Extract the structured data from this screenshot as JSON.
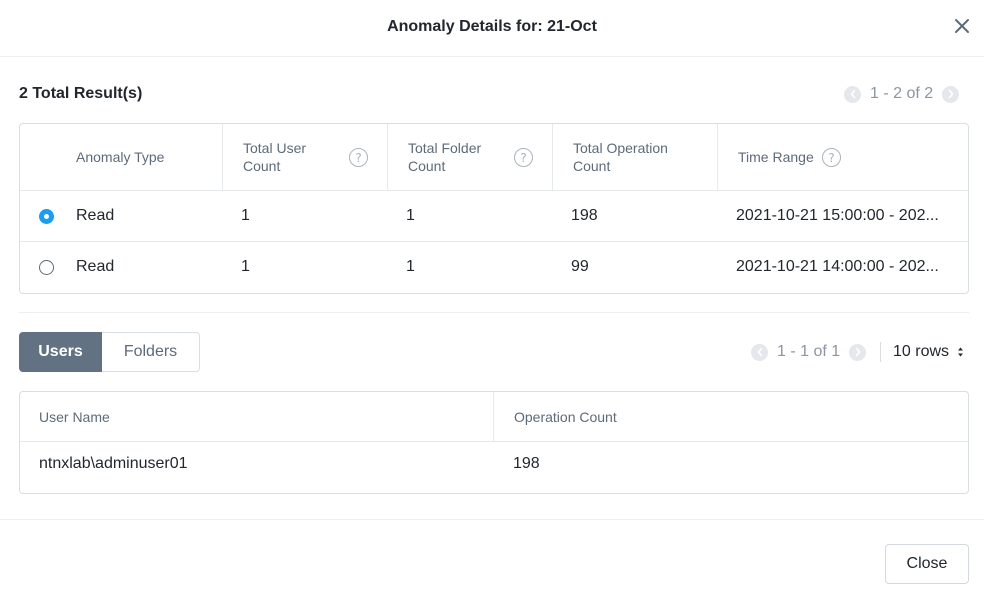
{
  "dialog": {
    "title": "Anomaly Details for: 21-Oct",
    "close_icon": "close-icon",
    "footer_close_label": "Close"
  },
  "results": {
    "title": "2 Total Result(s)",
    "pagination": "1 - 2 of 2",
    "columns": [
      "Anomaly Type",
      "Total User Count",
      "Total Folder Count",
      "Total Operation Count",
      "Time Range"
    ],
    "rows": [
      {
        "selected": true,
        "anomaly_type": "Read",
        "user_count": "1",
        "folder_count": "1",
        "operation_count": "198",
        "time_range": "2021-10-21 15:00:00 - 202..."
      },
      {
        "selected": false,
        "anomaly_type": "Read",
        "user_count": "1",
        "folder_count": "1",
        "operation_count": "99",
        "time_range": "2021-10-21 14:00:00 - 202..."
      }
    ]
  },
  "details": {
    "tabs": [
      "Users",
      "Folders"
    ],
    "active_tab": "Users",
    "pagination": "1 - 1 of 1",
    "rows_per_page": "10 rows",
    "columns": [
      "User Name",
      "Operation Count"
    ],
    "rows": [
      {
        "user_name": "ntnxlab\\adminuser01",
        "operation_count": "198"
      }
    ]
  },
  "colors": {
    "accent": "#1b9df0",
    "active_tab": "#627282",
    "header_text": "#5d6b78",
    "border": "#d9dee3"
  }
}
